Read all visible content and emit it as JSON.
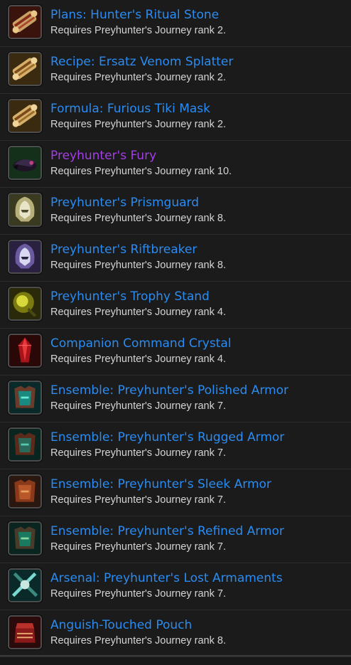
{
  "items": [
    {
      "name": "Plans: Hunter's Ritual Stone",
      "requirement": "Requires Preyhunter's Journey rank 2.",
      "quality": "rare",
      "icon": "scroll-icon"
    },
    {
      "name": "Recipe: Ersatz Venom Splatter",
      "requirement": "Requires Preyhunter's Journey rank 2.",
      "quality": "rare",
      "icon": "scroll-icon"
    },
    {
      "name": "Formula: Furious Tiki Mask",
      "requirement": "Requires Preyhunter's Journey rank 2.",
      "quality": "rare",
      "icon": "scroll-icon"
    },
    {
      "name": "Preyhunter's Fury",
      "requirement": "Requires Preyhunter's Journey rank 10.",
      "quality": "epic",
      "icon": "mount-icon"
    },
    {
      "name": "Preyhunter's Prismguard",
      "requirement": "Requires Preyhunter's Journey rank 8.",
      "quality": "rare",
      "icon": "gold-helm-icon"
    },
    {
      "name": "Preyhunter's Riftbreaker",
      "requirement": "Requires Preyhunter's Journey rank 8.",
      "quality": "rare",
      "icon": "violet-helm-icon"
    },
    {
      "name": "Preyhunter's Trophy Stand",
      "requirement": "Requires Preyhunter's Journey rank 4.",
      "quality": "rare",
      "icon": "trophy-icon"
    },
    {
      "name": "Companion Command Crystal",
      "requirement": "Requires Preyhunter's Journey rank 4.",
      "quality": "rare",
      "icon": "red-crystal-icon"
    },
    {
      "name": "Ensemble: Preyhunter's Polished Armor",
      "requirement": "Requires Preyhunter's Journey rank 7.",
      "quality": "rare",
      "icon": "teal-chest-armor-icon"
    },
    {
      "name": "Ensemble: Preyhunter's Rugged Armor",
      "requirement": "Requires Preyhunter's Journey rank 7.",
      "quality": "rare",
      "icon": "brown-chest-armor-icon"
    },
    {
      "name": "Ensemble: Preyhunter's Sleek Armor",
      "requirement": "Requires Preyhunter's Journey rank 7.",
      "quality": "rare",
      "icon": "leather-chest-armor-icon"
    },
    {
      "name": "Ensemble: Preyhunter's Refined Armor",
      "requirement": "Requires Preyhunter's Journey rank 7.",
      "quality": "rare",
      "icon": "green-chest-armor-icon"
    },
    {
      "name": "Arsenal: Preyhunter's Lost Armaments",
      "requirement": "Requires Preyhunter's Journey rank 7.",
      "quality": "rare",
      "icon": "weapons-icon"
    },
    {
      "name": "Anguish-Touched Pouch",
      "requirement": "Requires Preyhunter's Journey rank 8.",
      "quality": "rare",
      "icon": "pouch-icon"
    }
  ],
  "colors": {
    "rare": "#2a8cf2",
    "epic": "#a43ee6",
    "requirement_text": "#d4d4d4",
    "background": "#1b1b1b"
  }
}
